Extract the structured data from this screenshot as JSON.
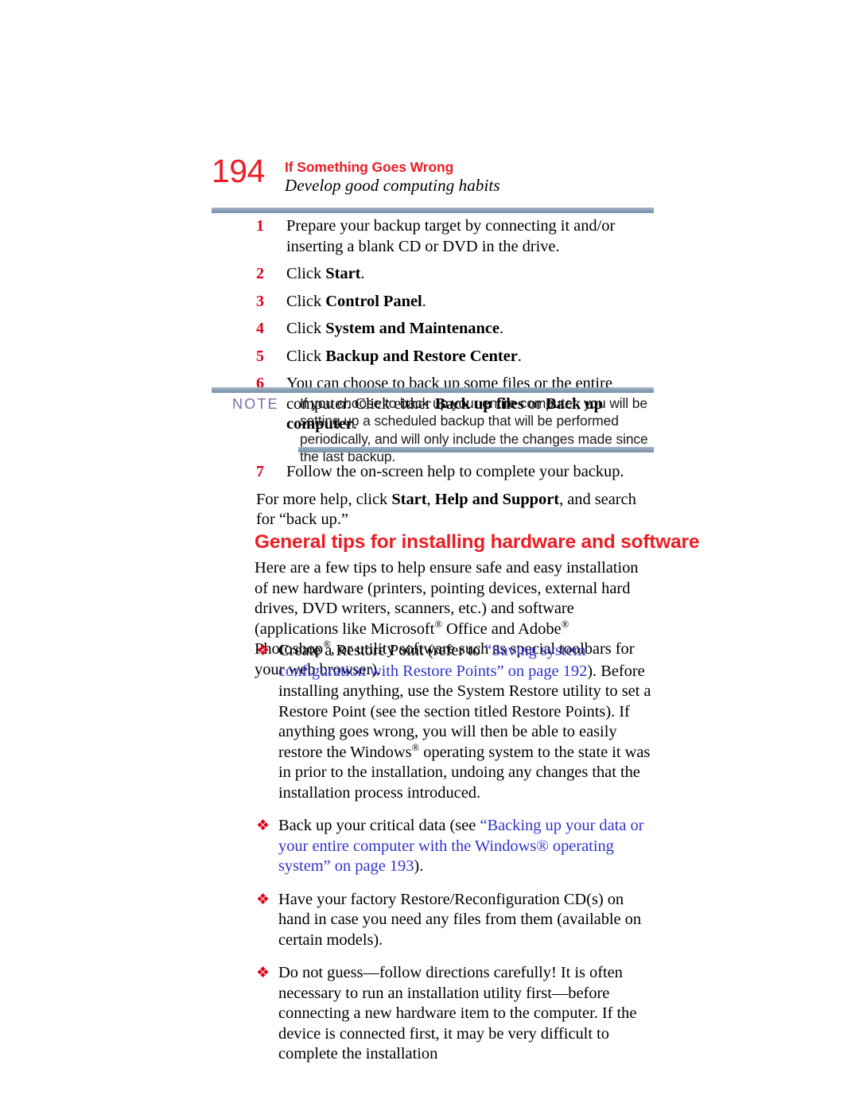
{
  "header": {
    "page_number": "194",
    "chapter_title": "If Something Goes Wrong",
    "section_title": "Develop good computing habits",
    "accent_red": "#ed1c24",
    "rule_color": "#8ba0b8"
  },
  "steps": [
    {
      "number": "1",
      "text": "Prepare your backup target by connecting it and/or inserting a blank CD or DVD in the drive."
    },
    {
      "number": "2",
      "prefix": "Click ",
      "bold": "Start",
      "suffix": "."
    },
    {
      "number": "3",
      "prefix": "Click ",
      "bold": "Control Panel",
      "suffix": "."
    },
    {
      "number": "4",
      "prefix": "Click ",
      "bold": "System and Maintenance",
      "suffix": "."
    },
    {
      "number": "5",
      "prefix": "Click ",
      "bold": "Backup and Restore Center",
      "suffix": "."
    },
    {
      "number": "6",
      "line1": "You can choose to back up some files or the entire computer.",
      "line2_prefix": "Click either ",
      "line2_bold1": "Back up files",
      "line2_mid": " or ",
      "line2_bold2": "Back up computer",
      "line2_suffix": "."
    }
  ],
  "note": {
    "label": "NOTE",
    "label_color": "#7b6bab",
    "body": "If you choose to back up your entire computer, you will be setting up a scheduled backup that will be performed periodically, and will only include the changes made since the last backup."
  },
  "post_note": {
    "step7_number": "7",
    "step7_text": "Follow the on-screen help to complete your backup.",
    "more_help_prefix": "For more help, click ",
    "more_help_bold1": "Start",
    "more_help_mid": ", ",
    "more_help_bold2": "Help and Support",
    "more_help_suffix": ", and search for “back up.”"
  },
  "section": {
    "heading": "General tips for installing hardware and software",
    "intro_part1": "Here are a few tips to help ensure safe and easy installation of new hardware (printers, pointing devices, external hard drives, DVD writers, scanners, etc.) and software (applications like Microsoft",
    "intro_part2": " Office and Adobe",
    "intro_part3": " Photoshop",
    "intro_part4": ", or utility software such as special toolbars for your web browser)."
  },
  "bullets": [
    {
      "marker": "❖",
      "part1": "Create a Restore Point (refer to ",
      "link1": "“Saving system configuration with Restore Points” on page 192",
      "part2": "). Before installing anything, use the System Restore utility to set a Restore Point (see the section titled Restore Points). If anything goes wrong, you will then be able to easily restore the Windows",
      "part3": " operating system to the state it was in prior to the installation, undoing any changes that the installation process introduced."
    },
    {
      "marker": "❖",
      "part1": "Back up your critical data (see ",
      "link1": "“Backing up your data or your entire computer with the Windows® operating system” on page 193",
      "part2": ")."
    },
    {
      "marker": "❖",
      "part1": "Have your factory Restore/Reconfiguration CD(s) on hand in case you need any files from them (available on certain models)."
    },
    {
      "marker": "❖",
      "part1": "Do not guess—follow directions carefully! It is often necessary to run an installation utility first—before connecting a new hardware item to the computer. If the device is connected first, it may be very difficult to complete the installation"
    }
  ],
  "symbols": {
    "registered": "®"
  }
}
